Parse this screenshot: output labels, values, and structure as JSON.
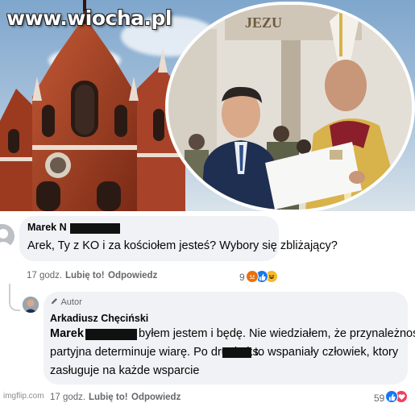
{
  "watermark": "www.wiocha.pl",
  "photo_banner_text": "JEZU",
  "comment": {
    "author": "Marek N",
    "text": "Arek, Ty z KO i za kościołem jesteś? Wybory się zbliżający?",
    "time": "17 godz.",
    "like_label": "Lubię to!",
    "reply_label": "Odpowiedz",
    "reaction_count": "9",
    "reactions": [
      "angry",
      "like",
      "haha"
    ]
  },
  "reply": {
    "badge_label": "Autor",
    "author": "Arkadiusz Chęciński",
    "mention": "Marek N",
    "text_line1": "byłem jestem i będę. Nie wiedziałem, że przynależność",
    "text_line2_a": "partyjna determinuje wiarę. Po drugie ks.",
    "text_line2_b": "to wspaniały człowiek, ktory",
    "text_line3": "zasługuje na każde wsparcie",
    "time": "17 godz.",
    "like_label": "Lubię to!",
    "reply_label": "Odpowiedz",
    "reaction_count": "59",
    "reactions": [
      "like",
      "love"
    ]
  },
  "footer_watermark": "imgflip.com",
  "colors": {
    "like": "#1877f2",
    "love": "#f33e58",
    "angry": "#e9710f",
    "haha": "#f7b928",
    "bubble": "#f0f2f5",
    "meta": "#65676b"
  }
}
